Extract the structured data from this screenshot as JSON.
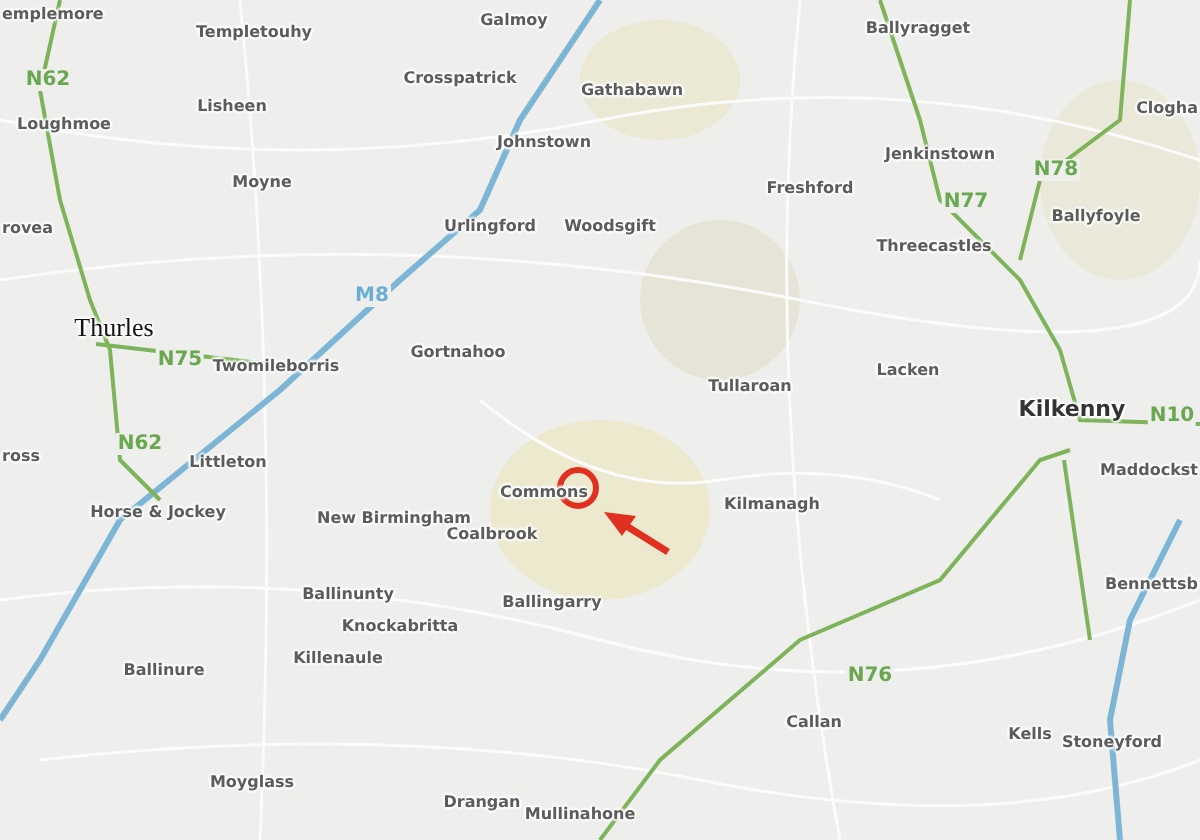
{
  "map": {
    "places": [
      {
        "name": "emplemore",
        "kind": "town"
      },
      {
        "name": "Templetouhy",
        "kind": "town"
      },
      {
        "name": "Galmoy",
        "kind": "town"
      },
      {
        "name": "Ballyragget",
        "kind": "town"
      },
      {
        "name": "Lisheen",
        "kind": "town"
      },
      {
        "name": "Crosspatrick",
        "kind": "town"
      },
      {
        "name": "Gathabawn",
        "kind": "town"
      },
      {
        "name": "Clogha",
        "kind": "town"
      },
      {
        "name": "Loughmoe",
        "kind": "town"
      },
      {
        "name": "Johnstown",
        "kind": "town"
      },
      {
        "name": "Jenkinstown",
        "kind": "town"
      },
      {
        "name": "Moyne",
        "kind": "town"
      },
      {
        "name": "Freshford",
        "kind": "town"
      },
      {
        "name": "rovea",
        "kind": "town"
      },
      {
        "name": "Urlingford",
        "kind": "town"
      },
      {
        "name": "Woodsgift",
        "kind": "town"
      },
      {
        "name": "Threecastles",
        "kind": "town"
      },
      {
        "name": "Ballyfoyle",
        "kind": "town"
      },
      {
        "name": "Thurles",
        "kind": "city"
      },
      {
        "name": "Twomileborris",
        "kind": "town"
      },
      {
        "name": "Gortnahoo",
        "kind": "town"
      },
      {
        "name": "Tullaroan",
        "kind": "town"
      },
      {
        "name": "Lacken",
        "kind": "town"
      },
      {
        "name": "Kilkenny",
        "kind": "major"
      },
      {
        "name": "ross",
        "kind": "town"
      },
      {
        "name": "Littleton",
        "kind": "town"
      },
      {
        "name": "Horse & Jockey",
        "kind": "town"
      },
      {
        "name": "New Birmingham",
        "kind": "town"
      },
      {
        "name": "Coalbrook",
        "kind": "town"
      },
      {
        "name": "Commons",
        "kind": "town"
      },
      {
        "name": "Kilmanagh",
        "kind": "town"
      },
      {
        "name": "Maddockst",
        "kind": "town"
      },
      {
        "name": "Ballinunty",
        "kind": "town"
      },
      {
        "name": "Ballingarry",
        "kind": "town"
      },
      {
        "name": "Bennettsb",
        "kind": "town"
      },
      {
        "name": "Knockabritta",
        "kind": "town"
      },
      {
        "name": "Ballinure",
        "kind": "town"
      },
      {
        "name": "Killenaule",
        "kind": "town"
      },
      {
        "name": "Callan",
        "kind": "town"
      },
      {
        "name": "Kells",
        "kind": "town"
      },
      {
        "name": "Stoneyford",
        "kind": "town"
      },
      {
        "name": "Moyglass",
        "kind": "town"
      },
      {
        "name": "Drangan",
        "kind": "town"
      },
      {
        "name": "Mullinahone",
        "kind": "town"
      }
    ],
    "road_labels": [
      {
        "label": "N62",
        "kind": "national"
      },
      {
        "label": "N78",
        "kind": "national"
      },
      {
        "label": "N77",
        "kind": "national"
      },
      {
        "label": "M8",
        "kind": "motorway"
      },
      {
        "label": "N75",
        "kind": "national"
      },
      {
        "label": "N10",
        "kind": "national"
      },
      {
        "label": "N62",
        "kind": "national"
      },
      {
        "label": "N76",
        "kind": "national"
      }
    ]
  }
}
